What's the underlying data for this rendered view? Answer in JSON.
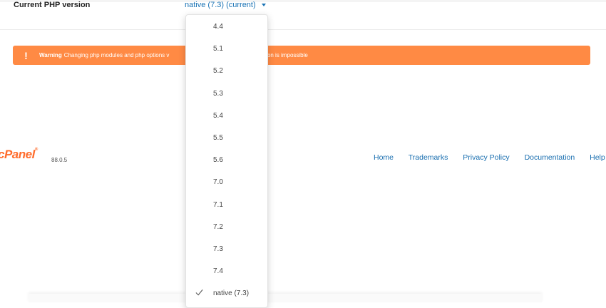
{
  "php_version": {
    "label": "Current PHP version",
    "selected": "native (7.3) (current)"
  },
  "warning": {
    "icon": "!",
    "strong": "Warning",
    "text_before": "Changing php modules and php options v",
    "text_after": "p version is impossible"
  },
  "dropdown": {
    "items": [
      {
        "label": "4.4"
      },
      {
        "label": "5.1"
      },
      {
        "label": "5.2"
      },
      {
        "label": "5.3"
      },
      {
        "label": "5.4"
      },
      {
        "label": "5.5"
      },
      {
        "label": "5.6"
      },
      {
        "label": "7.0"
      },
      {
        "label": "7.1"
      },
      {
        "label": "7.2"
      },
      {
        "label": "7.3"
      },
      {
        "label": "7.4"
      },
      {
        "label": "native (7.3)",
        "checked": true
      }
    ]
  },
  "footer": {
    "logo": "cPanel",
    "logo_reg": "®",
    "build": "88.0.5",
    "links": [
      "Home",
      "Trademarks",
      "Privacy Policy",
      "Documentation",
      "Help"
    ]
  },
  "colors": {
    "warning_bg": "#ff8a44",
    "link": "#1a73b5",
    "brand": "#ff6c2c"
  }
}
